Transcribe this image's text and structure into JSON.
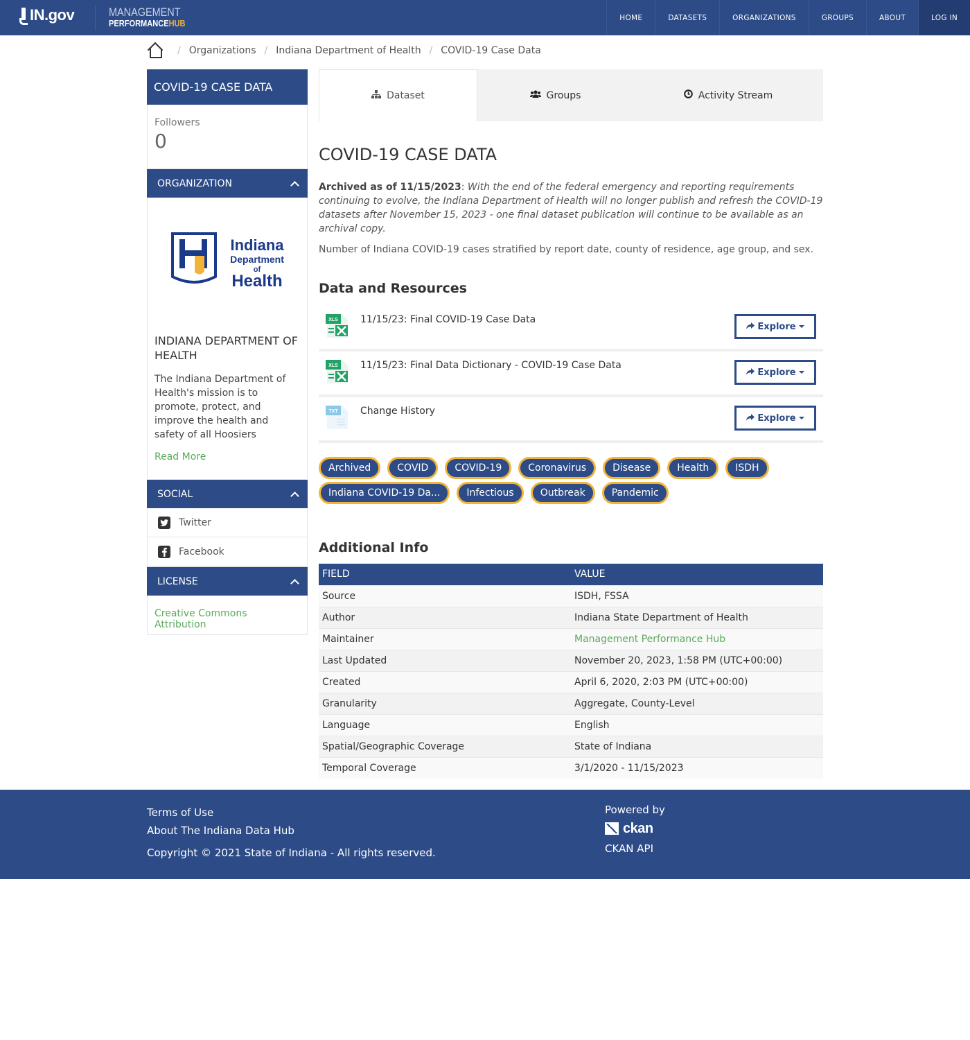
{
  "header": {
    "ingov_logo_text": "IN.gov",
    "brand_line1": "MANAGEMENT",
    "brand_line2_a": "PERFORMANCE",
    "brand_line2_b": "HUB",
    "nav": [
      "HOME",
      "DATASETS",
      "ORGANIZATIONS",
      "GROUPS",
      "ABOUT",
      "LOG IN"
    ]
  },
  "breadcrumb": {
    "items": [
      "Organizations",
      "Indiana Department of Health",
      "COVID-19 Case Data"
    ],
    "separator": "/"
  },
  "sidebar": {
    "title": "COVID-19 CASE DATA",
    "followers_label": "Followers",
    "followers_count": "0",
    "organization_heading": "ORGANIZATION",
    "logo_text": [
      "Indiana",
      "Department",
      "of",
      "Health"
    ],
    "org_name": "INDIANA DEPARTMENT OF HEALTH",
    "org_description": "The Indiana Department of Health's mission is to promote, protect, and improve the health and safety of all Hoosiers",
    "read_more": "Read More",
    "social_heading": "SOCIAL",
    "social": [
      "Twitter",
      "Facebook"
    ],
    "license_heading": "LICENSE",
    "license": "Creative Commons Attribution"
  },
  "tabs": [
    "Dataset",
    "Groups",
    "Activity Stream"
  ],
  "dataset": {
    "title": "COVID-19 CASE DATA",
    "archived_label": "Archived as of 11/15/2023",
    "archived_text": "With the end of the federal emergency and reporting requirements continuing to evolve, the Indiana Department of Health will no longer publish and refresh the COVID-19 datasets after November 15, 2023 - one final dataset publication will continue to be available as an archival copy.",
    "summary": "Number of Indiana COVID-19 cases stratified by report date, county of residence, age group, and sex."
  },
  "resources": {
    "heading": "Data and Resources",
    "explore_label": "Explore",
    "items": [
      {
        "name": "11/15/23: Final COVID-19 Case Data",
        "format": "XLS"
      },
      {
        "name": "11/15/23: Final Data Dictionary - COVID-19 Case Data",
        "format": "XLS"
      },
      {
        "name": "Change History",
        "format": "TXT"
      }
    ]
  },
  "tags": [
    "Archived",
    "COVID",
    "COVID-19",
    "Coronavirus",
    "Disease",
    "Health",
    "ISDH",
    "Indiana COVID-19 Da...",
    "Infectious",
    "Outbreak",
    "Pandemic"
  ],
  "additional_info": {
    "heading": "Additional Info",
    "col_field": "FIELD",
    "col_value": "VALUE",
    "rows": [
      {
        "field": "Source",
        "value": "ISDH, FSSA"
      },
      {
        "field": "Author",
        "value": "Indiana State Department of Health"
      },
      {
        "field": "Maintainer",
        "value": "Management Performance Hub"
      },
      {
        "field": "Last Updated",
        "value": "November 20, 2023, 1:58 PM (UTC+00:00)"
      },
      {
        "field": "Created",
        "value": "April 6, 2020, 2:03 PM (UTC+00:00)"
      },
      {
        "field": "Granularity",
        "value": "Aggregate, County-Level"
      },
      {
        "field": "Language",
        "value": "English"
      },
      {
        "field": "Spatial/Geographic Coverage",
        "value": "State of Indiana"
      },
      {
        "field": "Temporal Coverage",
        "value": "3/1/2020 - 11/15/2023"
      }
    ]
  },
  "footer": {
    "terms": "Terms of Use",
    "about": "About The Indiana Data Hub",
    "copyright": "Copyright © 2021 State of Indiana - All rights reserved.",
    "powered_by": "Powered by",
    "ckan": "ckan",
    "ckan_api": "CKAN API"
  },
  "colors": {
    "primary": "#2c4b87",
    "accent": "#f2b33a",
    "link": "#5aaa5d",
    "excel_green": "#21a366"
  }
}
